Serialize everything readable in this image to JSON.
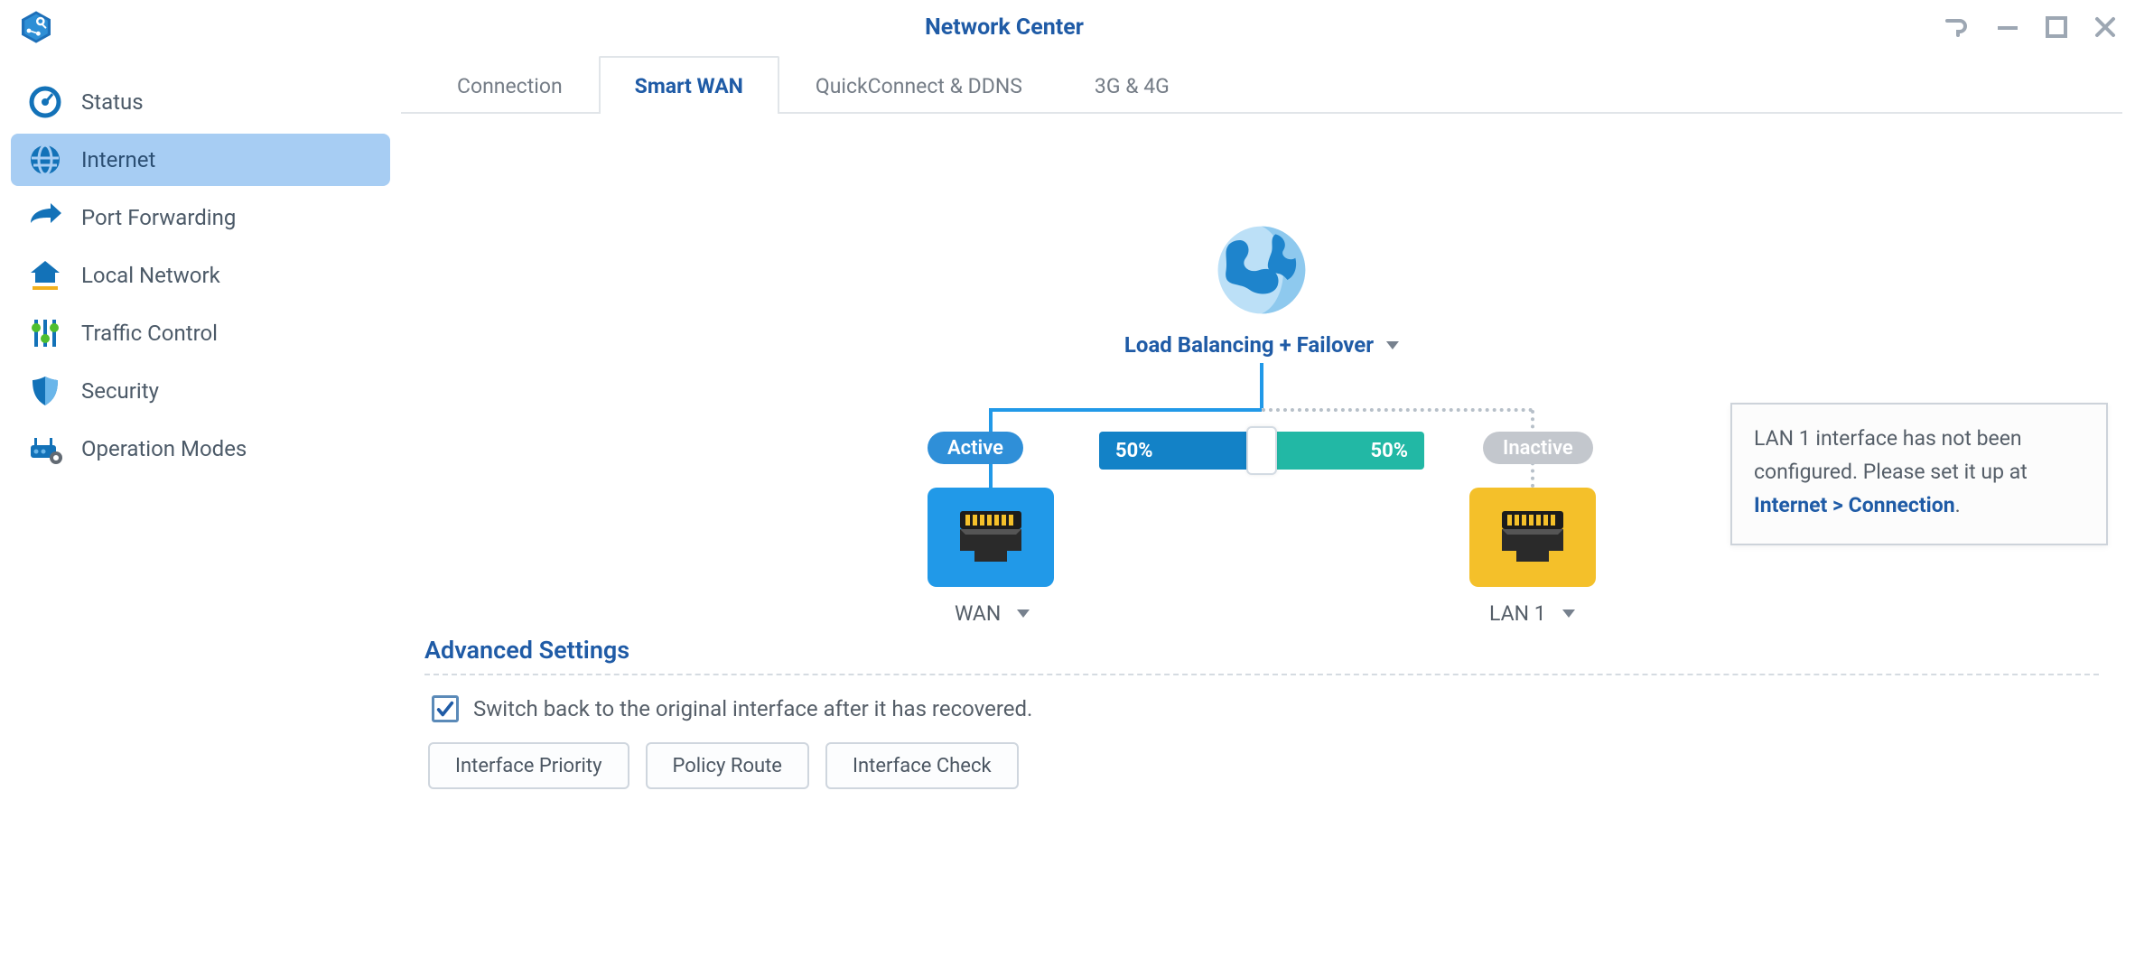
{
  "header": {
    "title": "Network Center"
  },
  "sidebar": [
    {
      "id": "status",
      "label": "Status",
      "active": false
    },
    {
      "id": "internet",
      "label": "Internet",
      "active": true
    },
    {
      "id": "portfwd",
      "label": "Port Forwarding",
      "active": false
    },
    {
      "id": "localnet",
      "label": "Local Network",
      "active": false
    },
    {
      "id": "traffic",
      "label": "Traffic Control",
      "active": false
    },
    {
      "id": "security",
      "label": "Security",
      "active": false
    },
    {
      "id": "opmodes",
      "label": "Operation Modes",
      "active": false
    }
  ],
  "tabs": [
    {
      "label": "Connection",
      "active": false
    },
    {
      "label": "Smart WAN",
      "active": true
    },
    {
      "label": "QuickConnect & DDNS",
      "active": false
    },
    {
      "label": "3G & 4G",
      "active": false
    }
  ],
  "smartwan": {
    "mode_label": "Load Balancing + Failover",
    "left": {
      "status": "Active",
      "pct": "50%",
      "iface": "WAN"
    },
    "right": {
      "status": "Inactive",
      "pct": "50%",
      "iface": "LAN 1"
    },
    "tooltip": {
      "line1": "LAN 1 interface has not been configured. Please set it up at ",
      "link": "Internet > Connection",
      "period": "."
    }
  },
  "advanced": {
    "title": "Advanced Settings",
    "checkbox_label": "Switch back to the original interface after it has recovered.",
    "checkbox_checked": true,
    "buttons": [
      {
        "label": "Interface Priority"
      },
      {
        "label": "Policy Route"
      },
      {
        "label": "Interface Check"
      }
    ]
  }
}
